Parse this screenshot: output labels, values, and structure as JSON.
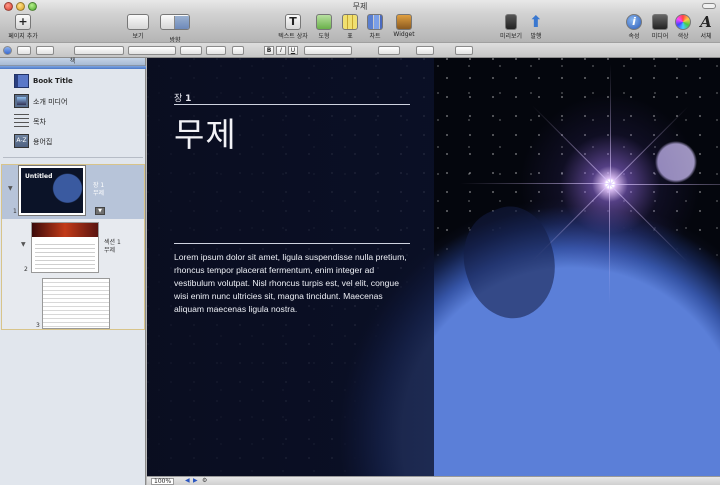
{
  "window": {
    "title": "무제"
  },
  "toolbar": {
    "add_page": "페이지 추가",
    "view": "보기",
    "orientation": "방향",
    "text_box": "텍스트 상자",
    "shapes": "도형",
    "table": "표",
    "charts": "차트",
    "widget": "Widget",
    "preview": "미리보기",
    "publish": "발행",
    "inspector": "속성",
    "media": "미디어",
    "colors": "색상",
    "fonts": "서체"
  },
  "sidebar": {
    "header": "책",
    "items": [
      {
        "label": "Book Title",
        "icon": "book-icon"
      },
      {
        "label": "소개 미디어",
        "icon": "media-icon"
      },
      {
        "label": "목차",
        "icon": "toc-icon"
      },
      {
        "label": "용어집",
        "icon": "glossary-icon",
        "glyph": "A-Z"
      }
    ],
    "pages": [
      {
        "number": "1",
        "caption": "장 1\n무제",
        "thumb_title": "Untitled"
      },
      {
        "number": "2",
        "caption": "섹션 1\n무제"
      },
      {
        "number": "3",
        "caption": ""
      }
    ]
  },
  "content": {
    "chapter_prefix": "장",
    "chapter_number": "1",
    "title": "무제",
    "body": "Lorem ipsum dolor sit amet, ligula suspendisse nulla pretium, rhoncus tempor placerat fermentum, enim integer ad vestibulum volutpat. Nisl rhoncus turpis est, vel elit, congue wisi enim nunc ultricies sit, magna tincidunt. Maecenas aliquam maecenas ligula nostra."
  },
  "statusbar": {
    "zoom": "100%"
  }
}
